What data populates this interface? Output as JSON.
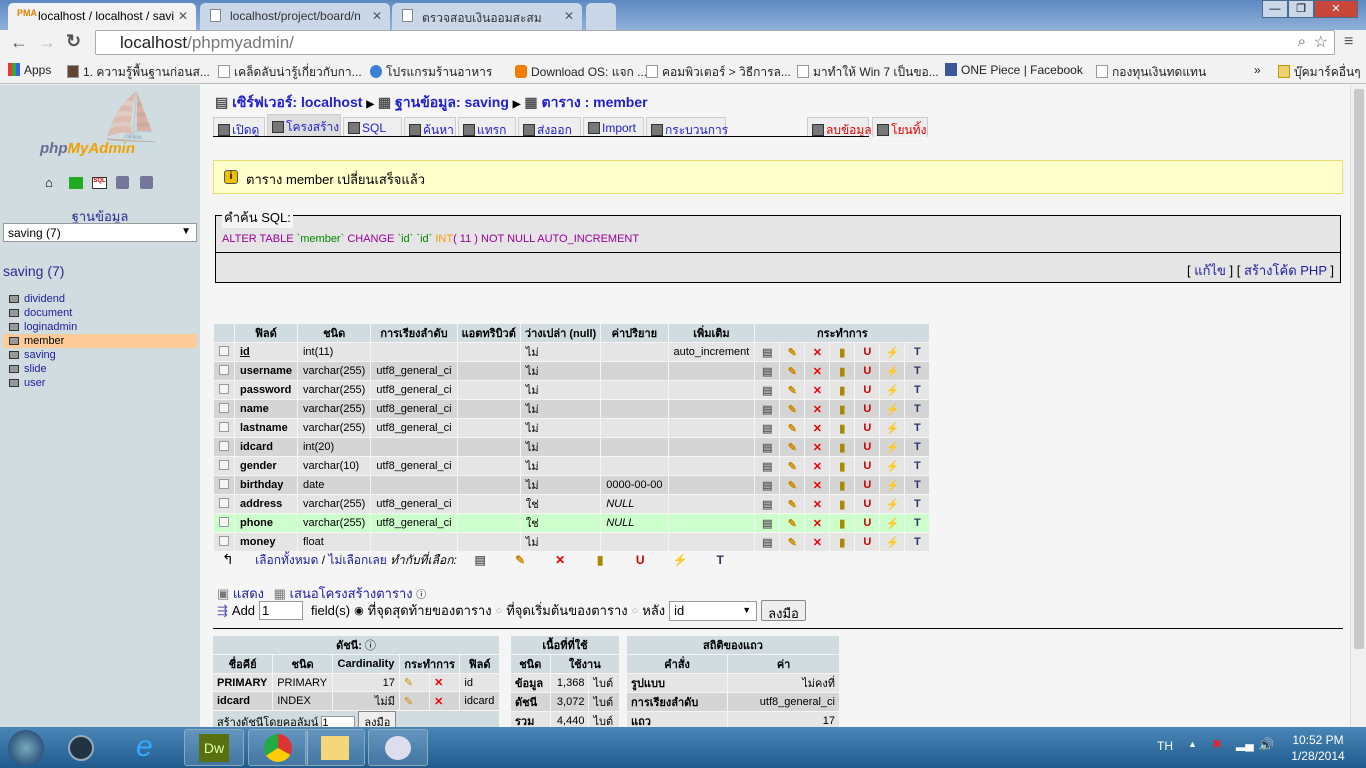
{
  "browser": {
    "tabs": [
      {
        "title": "localhost / localhost / savi"
      },
      {
        "title": "localhost/project/board/n"
      },
      {
        "title": "ตรวจสอบเงินออมสะสม"
      }
    ],
    "url_host": "localhost",
    "url_path": "/phpmyadmin/",
    "bookmarks": [
      "Apps",
      "1. ความรู้พื้นฐานก่อนส...",
      "เคล็ดลับน่ารู้เกี่ยวกับกา...",
      "โปรแกรมร้านอาหาร",
      "Download OS: แจก ...",
      "คอมพิวเตอร์ > วิธีการล...",
      "มาทำให้ Win 7 เป็นขอ...",
      "ONE Piece | Facebook",
      "กองทุนเงินทดแทน"
    ],
    "more": "»",
    "other_bookmarks": "บุ๊คมาร์คอื่นๆ"
  },
  "sidebar": {
    "logo": "phpMyAdmin",
    "db_label": "ฐานข้อมูล",
    "db_select": "saving (7)",
    "db_title": "saving (7)",
    "tables": [
      "dividend",
      "document",
      "loginadmin",
      "member",
      "saving",
      "slide",
      "user"
    ],
    "selected": "member"
  },
  "breadcrumb": {
    "server": "เซิร์ฟเวอร์: localhost",
    "database": "ฐานข้อมูล: saving",
    "table": "ตาราง : member"
  },
  "tabs": [
    {
      "label": "เปิดดู"
    },
    {
      "label": "โครงสร้าง",
      "active": true
    },
    {
      "label": "SQL"
    },
    {
      "label": "ค้นหา"
    },
    {
      "label": "แทรก"
    },
    {
      "label": "ส่งออก"
    },
    {
      "label": "Import"
    },
    {
      "label": "กระบวนการ"
    },
    {
      "label": "ลบข้อมูล",
      "danger": true
    },
    {
      "label": "โยนทิ้ง",
      "danger": true
    }
  ],
  "notice": "ตาราง member เปลี่ยนเสร็จแล้ว",
  "sql": {
    "legend": "คำค้น SQL:",
    "parts": [
      "ALTER TABLE ",
      "`member`",
      " CHANGE ",
      "`id`",
      " ",
      "`id`",
      " INT",
      "( 11 )",
      " NOT NULL AUTO_INCREMENT"
    ],
    "edit": "แก้ไข",
    "php": "สร้างโค้ด PHP"
  },
  "structure": {
    "headers": [
      "ฟิลด์",
      "ชนิด",
      "การเรียงลำดับ",
      "แอตทริบิวต์",
      "ว่างเปล่า (null)",
      "ค่าปริยาย",
      "เพิ่มเติม",
      "กระทำการ"
    ],
    "rows": [
      {
        "field": "id",
        "type": "int(11)",
        "collation": "",
        "attr": "",
        "null": "ไม่",
        "default": "",
        "extra": "auto_increment"
      },
      {
        "field": "username",
        "type": "varchar(255)",
        "collation": "utf8_general_ci",
        "attr": "",
        "null": "ไม่",
        "default": "",
        "extra": ""
      },
      {
        "field": "password",
        "type": "varchar(255)",
        "collation": "utf8_general_ci",
        "attr": "",
        "null": "ไม่",
        "default": "",
        "extra": ""
      },
      {
        "field": "name",
        "type": "varchar(255)",
        "collation": "utf8_general_ci",
        "attr": "",
        "null": "ไม่",
        "default": "",
        "extra": ""
      },
      {
        "field": "lastname",
        "type": "varchar(255)",
        "collation": "utf8_general_ci",
        "attr": "",
        "null": "ไม่",
        "default": "",
        "extra": ""
      },
      {
        "field": "idcard",
        "type": "int(20)",
        "collation": "",
        "attr": "",
        "null": "ไม่",
        "default": "",
        "extra": ""
      },
      {
        "field": "gender",
        "type": "varchar(10)",
        "collation": "utf8_general_ci",
        "attr": "",
        "null": "ไม่",
        "default": "",
        "extra": ""
      },
      {
        "field": "birthday",
        "type": "date",
        "collation": "",
        "attr": "",
        "null": "ไม่",
        "default": "0000-00-00",
        "extra": ""
      },
      {
        "field": "address",
        "type": "varchar(255)",
        "collation": "utf8_general_ci",
        "attr": "",
        "null": "ใช่",
        "default": "NULL",
        "extra": ""
      },
      {
        "field": "phone",
        "type": "varchar(255)",
        "collation": "utf8_general_ci",
        "attr": "",
        "null": "ใช่",
        "default": "NULL",
        "extra": "",
        "highlight": true
      },
      {
        "field": "money",
        "type": "float",
        "collation": "",
        "attr": "",
        "null": "ไม่",
        "default": "",
        "extra": ""
      }
    ],
    "check_all": "เลือกทั้งหมด",
    "uncheck_all": "ไม่เลือกเลย",
    "with_selected": "ทำกับที่เลือก:"
  },
  "links": {
    "print": "แสดง",
    "propose": "เสนอโครงสร้างตาราง"
  },
  "add_field": {
    "label": "Add",
    "count": "1",
    "suffix": "field(s)",
    "opt_end": "ที่จุดสุดท้ายของตาราง",
    "opt_begin": "ที่จุดเริ่มต้นของตาราง",
    "opt_after": "หลัง",
    "after_field": "id",
    "go": "ลงมือ"
  },
  "indexes": {
    "title": "ดัชนี:",
    "headers": [
      "ชื่อคีย์",
      "ชนิด",
      "Cardinality",
      "กระทำการ",
      "ฟิลด์"
    ],
    "rows": [
      {
        "key": "PRIMARY",
        "type": "PRIMARY",
        "card": "17",
        "field": "id"
      },
      {
        "key": "idcard",
        "type": "INDEX",
        "card": "ไม่มี",
        "field": "idcard"
      }
    ],
    "create_label": "สร้างดัชนีโดยคอลัมน์",
    "create_count": "1",
    "go": "ลงมือ"
  },
  "space": {
    "title": "เนื้อที่ที่ใช้",
    "headers": [
      "ชนิด",
      "ใช้งาน"
    ],
    "rows": [
      {
        "t": "ข้อมูล",
        "v": "1,368",
        "u": "ไบต์"
      },
      {
        "t": "ดัชนี",
        "v": "3,072",
        "u": "ไบต์"
      },
      {
        "t": "รวม",
        "v": "4,440",
        "u": "ไบต์"
      }
    ]
  },
  "rowstats": {
    "title": "สถิติของแถว",
    "headers": [
      "คำสั่ง",
      "ค่า"
    ],
    "rows": [
      {
        "k": "รูปแบบ",
        "v": "ไม่คงที่"
      },
      {
        "k": "การเรียงลำดับ",
        "v": "utf8_general_ci"
      },
      {
        "k": "แถว",
        "v": "17"
      }
    ]
  },
  "taskbar": {
    "lang": "TH",
    "time": "10:52 PM",
    "date": "1/28/2014",
    "apps": [
      "Dw"
    ]
  }
}
